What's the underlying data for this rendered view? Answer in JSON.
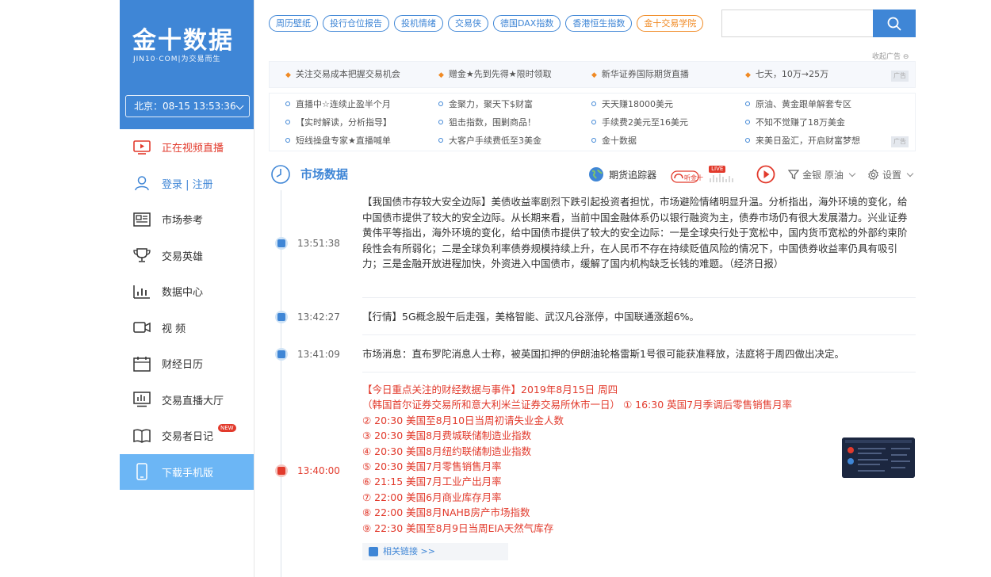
{
  "brand": {
    "logo": "金十数据",
    "subtitle": "JIN10·COM|为交易而生",
    "clock": "北京：08-15 13:53:36"
  },
  "sidebar": {
    "items": [
      {
        "label": "正在视频直播"
      },
      {
        "label": "登录 | 注册"
      },
      {
        "label": "市场参考"
      },
      {
        "label": "交易英雄"
      },
      {
        "label": "数据中心"
      },
      {
        "label": "视 频"
      },
      {
        "label": "财经日历"
      },
      {
        "label": "交易直播大厅"
      },
      {
        "label": "交易者日记",
        "badge": "NEW"
      },
      {
        "label": "下载手机版"
      }
    ]
  },
  "tags": [
    "周历壁纸",
    "投行仓位报告",
    "投机情绪",
    "交易侠",
    "德国DAX指数",
    "香港恒生指数",
    "金十交易学院"
  ],
  "search": {
    "placeholder": ""
  },
  "ads": {
    "close_label": "收起广告",
    "tag": "广告",
    "row1": [
      "关注交易成本把握交易机会",
      "赠金★先到先得★限时领取",
      "新华证券国际期货直播",
      "七天，10万→25万"
    ],
    "grid": [
      [
        "直播中☆连续止盈半个月",
        "金聚力，聚天下$财富",
        "天天赚18000美元",
        "原油、黄金跟单解套专区"
      ],
      [
        "【实时解读，分析指导】",
        "狙击指数，围剿商品！",
        "手续费2美元至16美元",
        "不知不觉赚了18万美金"
      ],
      [
        "短线操盘专家★直播喊单",
        "大客户手续费低至3美金",
        "金十数据",
        "来美日盈汇，开启财富梦想"
      ]
    ]
  },
  "market": {
    "title": "市场数据",
    "tracker": "期货追踪器",
    "live": "LIVE",
    "filter": "金银 原油",
    "settings": "设置"
  },
  "news": [
    {
      "time": "13:51:38",
      "text": "【我国债市存较大安全边际】美债收益率剧烈下跌引起投资者担忧，市场避险情绪明显升温。分析指出，海外环境的变化，给中国债市提供了较大的安全边际。从长期来看，当前中国金融体系仍以银行融资为主，债券市场仍有很大发展潜力。兴业证券黄伟平等指出，海外环境的变化，给中国债市提供了较大的安全边际：一是全球央行处于宽松中，国内货币宽松的外部约束阶段性会有所弱化；二是全球负利率债券规模持续上升，在人民币不存在持续贬值风险的情况下，中国债券收益率仍具有吸引力；三是金融开放进程加快，外资进入中国债市，缓解了国内机构缺乏长钱的难题。（经济日报）"
    },
    {
      "time": "13:42:27",
      "text": "【行情】5G概念股午后走强，美格智能、武汉凡谷涨停，中国联通涨超6%。"
    },
    {
      "time": "13:41:09",
      "text": "市场消息：直布罗陀消息人士称，被英国扣押的伊朗油轮格雷斯1号很可能获准释放，法庭将于周四做出决定。"
    },
    {
      "time": "13:40:00",
      "lines": [
        "【今日重点关注的财经数据与事件】2019年8月15日 周四",
        "（韩国首尔证券交易所和意大利米兰证券交易所休市一日） ① 16:30 英国7月季调后零售销售月率",
        "② 20:30 美国至8月10日当周初请失业金人数",
        "③ 20:30 美国8月费城联储制造业指数",
        "④ 20:30 美国8月纽约联储制造业指数",
        "⑤ 20:30 美国7月零售销售月率",
        "⑥ 21:15 美国7月工业产出月率",
        "⑦ 22:00 美国6月商业库存月率",
        "⑧ 22:00 美国8月NAHB房产市场指数",
        "⑨ 22:30 美国至8月9日当周EIA天然气库存"
      ],
      "related": "相关链接 >>"
    }
  ]
}
